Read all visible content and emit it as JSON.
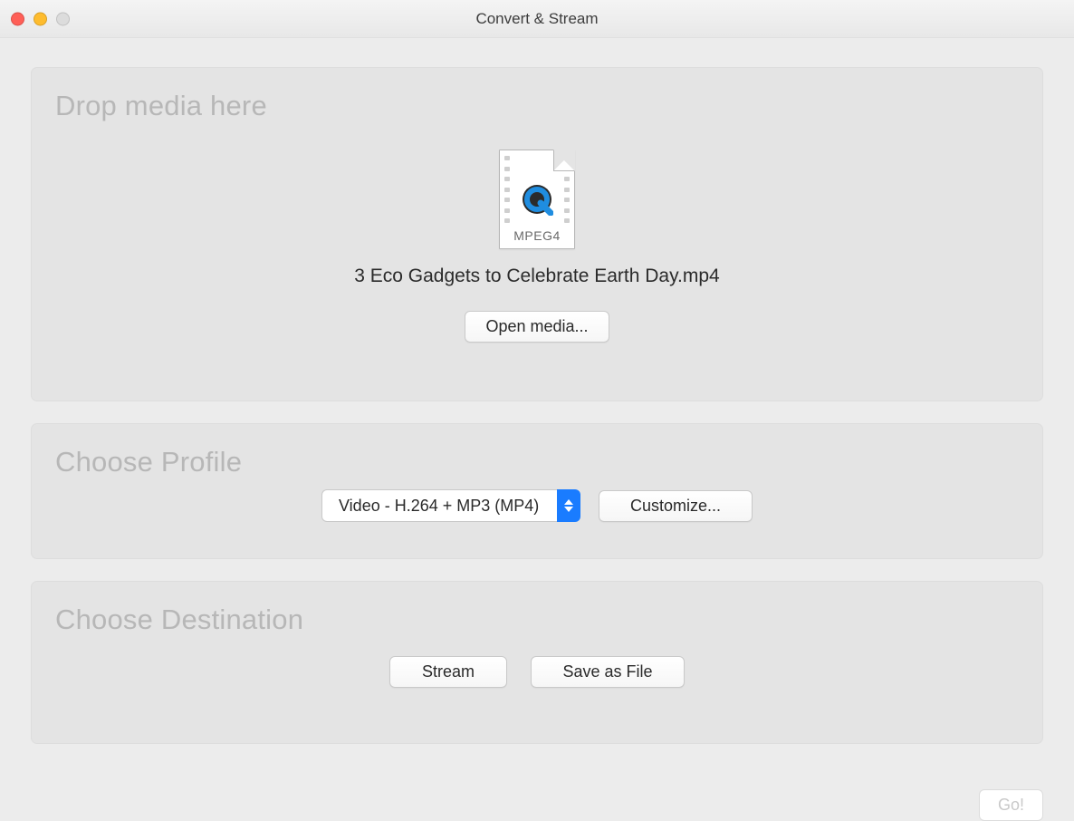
{
  "window": {
    "title": "Convert & Stream"
  },
  "drop": {
    "heading": "Drop media here",
    "file_type_label": "MPEG4",
    "file_name": "3 Eco Gadgets to Celebrate Earth Day.mp4",
    "open_button": "Open media..."
  },
  "profile": {
    "heading": "Choose Profile",
    "selected": "Video - H.264 + MP3 (MP4)",
    "customize_button": "Customize..."
  },
  "destination": {
    "heading": "Choose Destination",
    "stream_button": "Stream",
    "save_button": "Save as File"
  },
  "footer": {
    "go_button": "Go!"
  }
}
